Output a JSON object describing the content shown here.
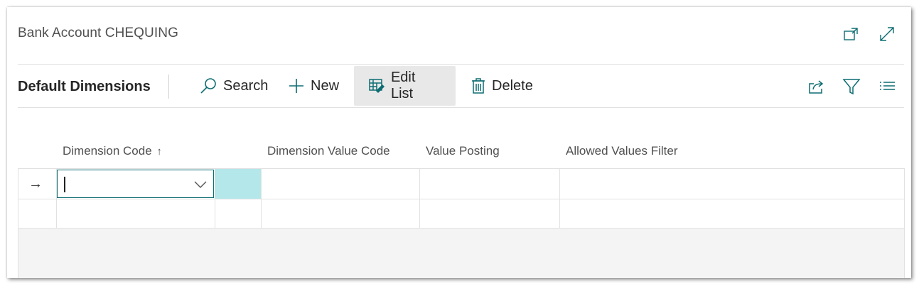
{
  "window": {
    "title": "Bank Account CHEQUING",
    "icons": [
      "open-in-new-window-icon",
      "expand-icon"
    ]
  },
  "command_bar": {
    "page_name": "Default Dimensions",
    "actions": [
      {
        "label": "Search",
        "icon": "search-icon"
      },
      {
        "label": "New",
        "icon": "plus-icon"
      },
      {
        "label": "Edit List",
        "icon": "edit-list-icon",
        "active": true
      },
      {
        "label": "Delete",
        "icon": "trash-icon"
      }
    ],
    "right_icons": [
      "share-icon",
      "filter-icon",
      "list-view-icon"
    ]
  },
  "grid": {
    "columns": [
      {
        "label": "Dimension Code",
        "sort": "ascending"
      },
      {
        "label": "Dimension Value Code"
      },
      {
        "label": "Value Posting"
      },
      {
        "label": "Allowed Values Filter"
      }
    ],
    "sort_indicator": "↑",
    "rows": [
      {
        "selector": "→",
        "dimension_code": "",
        "dimension_value_code": "",
        "value_posting": "",
        "allowed_values_filter": ""
      },
      {
        "selector": "",
        "dimension_code": "",
        "dimension_value_code": "",
        "value_posting": "",
        "allowed_values_filter": ""
      }
    ]
  },
  "colors": {
    "accent": "#0d6d72",
    "active_cell": "#b3e7ea",
    "active_button_bg": "#e8e8e8"
  }
}
